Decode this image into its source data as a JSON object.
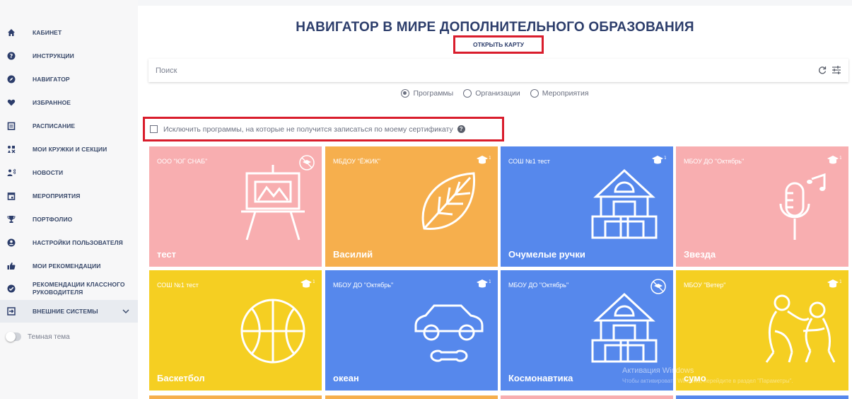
{
  "sidebar": {
    "items": [
      {
        "label": "КАБИНЕТ",
        "icon": "home-icon"
      },
      {
        "label": "ИНСТРУКЦИИ",
        "icon": "question-icon"
      },
      {
        "label": "НАВИГАТОР",
        "icon": "compass-icon"
      },
      {
        "label": "ИЗБРАННОЕ",
        "icon": "heart-icon"
      },
      {
        "label": "РАСПИСАНИЕ",
        "icon": "calendar-list-icon"
      },
      {
        "label": "МОИ КРУЖКИ И СЕКЦИИ",
        "icon": "clubs-icon"
      },
      {
        "label": "НОВОСТИ",
        "icon": "megaphone-icon"
      },
      {
        "label": "МЕРОПРИЯТИЯ",
        "icon": "event-calendar-icon"
      },
      {
        "label": "ПОРТФОЛИО",
        "icon": "trophy-icon"
      },
      {
        "label": "НАСТРОЙКИ ПОЛЬЗОВАТЕЛЯ",
        "icon": "user-settings-icon"
      },
      {
        "label": "МОИ РЕКОМЕНДАЦИИ",
        "icon": "thumbs-up-icon"
      },
      {
        "label": "РЕКОМЕНДАЦИИ КЛАССНОГО РУКОВОДИТЕЛЯ",
        "icon": "check-circle-icon"
      },
      {
        "label": "ВНЕШНИЕ СИСТЕМЫ",
        "icon": "external-icon"
      }
    ],
    "theme_label": "Темная тема"
  },
  "header": {
    "title": "НАВИГАТОР В МИРЕ ДОПОЛНИТЕЛЬНОГО ОБРАЗОВАНИЯ",
    "map_button": "ОТКРЫТЬ КАРТУ"
  },
  "search": {
    "placeholder": "Поиск"
  },
  "tabs": {
    "options": [
      "Программы",
      "Организации",
      "Мероприятия"
    ],
    "selected": "Программы"
  },
  "filter": {
    "label": "Исключить программы, на которые не получится записаться по моему сертификату",
    "checked": false
  },
  "cards": [
    {
      "org": "ООО \"ЮГ СНАБ\"",
      "name": "тест",
      "color": "#f8aeb0",
      "badge": "no-certificate-icon",
      "art": "easel-icon"
    },
    {
      "org": "МБДОУ \"ЁЖИК\"",
      "name": "Василий",
      "color": "#f6af4d",
      "badge": "graduation-cap-icon",
      "art": "leaf-icon"
    },
    {
      "org": "СОШ №1 тест",
      "name": "Очумелые ручки",
      "color": "#5688ec",
      "badge": "graduation-cap-icon",
      "art": "building-blocks-icon"
    },
    {
      "org": "МБОУ ДО \"Октябрь\"",
      "name": "Звезда",
      "color": "#f8aeb0",
      "badge": "graduation-cap-icon",
      "art": "microphone-icon"
    },
    {
      "org": "СОШ №1 тест",
      "name": "Баскетбол",
      "color": "#f5cf22",
      "badge": "graduation-cap-icon",
      "art": "basketball-icon"
    },
    {
      "org": "МБОУ ДО \"Октябрь\"",
      "name": "океан",
      "color": "#5688ec",
      "badge": "graduation-cap-icon",
      "art": "car-repair-icon"
    },
    {
      "org": "МБОУ ДО \"Октябрь\"",
      "name": "Космонавтика",
      "color": "#5688ec",
      "badge": "no-certificate-icon",
      "art": "building-blocks-icon"
    },
    {
      "org": "МБОУ \"Ветер\"",
      "name": "сумо",
      "color": "#f5cf22",
      "badge": "graduation-cap-icon",
      "art": "wrestlers-icon"
    }
  ],
  "watermark": {
    "line1": "Активация Windows",
    "line2": "Чтобы активировать Windows, перейдите в раздел \"Параметры\"."
  }
}
